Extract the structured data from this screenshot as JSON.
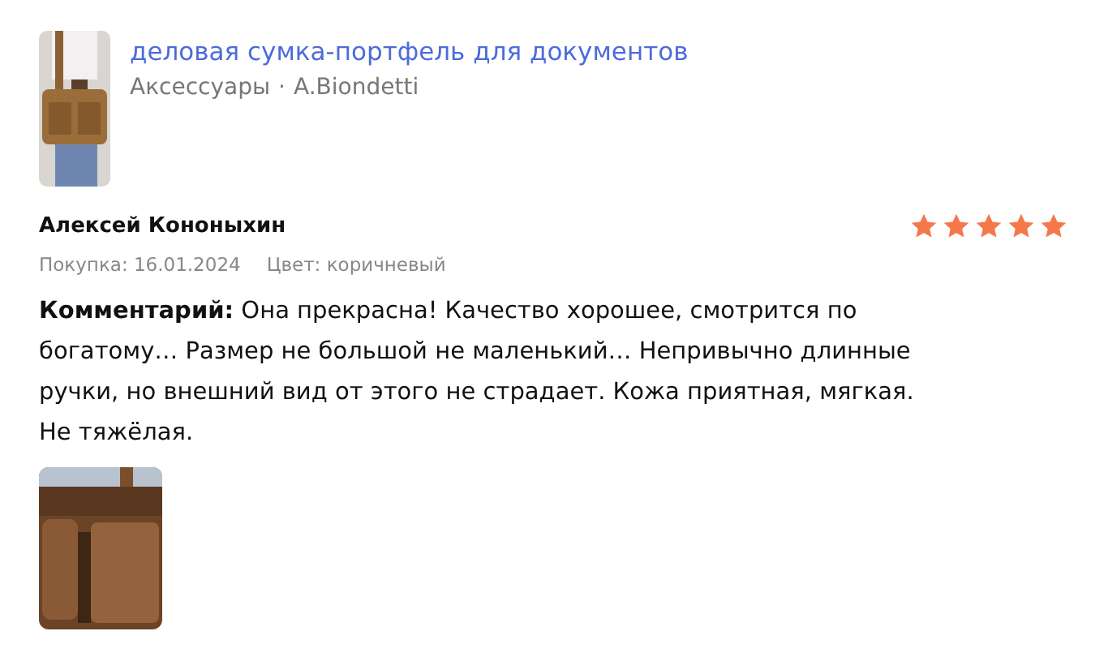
{
  "product": {
    "image": {
      "kind": "picture"
    },
    "title": "деловая сумка-портфель для документов",
    "category": "Аксессуары",
    "separator": "·",
    "brand": "A.Biondetti"
  },
  "review": {
    "author": "Алексей Кононыхин",
    "stars": 5,
    "purchase": "Покупка: 16.01.2024",
    "color_label": "Цвет: коричневый",
    "comment": "**Комментарий:** Она прекрасна! Качество хорошее, смотрится по богатому… Размер не большой не маленький… Непривычно длинные ручки, но внешний вид от этого не страдает. Кожа приятная, мягкая. Не тяжёлая.",
    "photos": [
      {
        "kind": "picture"
      }
    ]
  }
}
